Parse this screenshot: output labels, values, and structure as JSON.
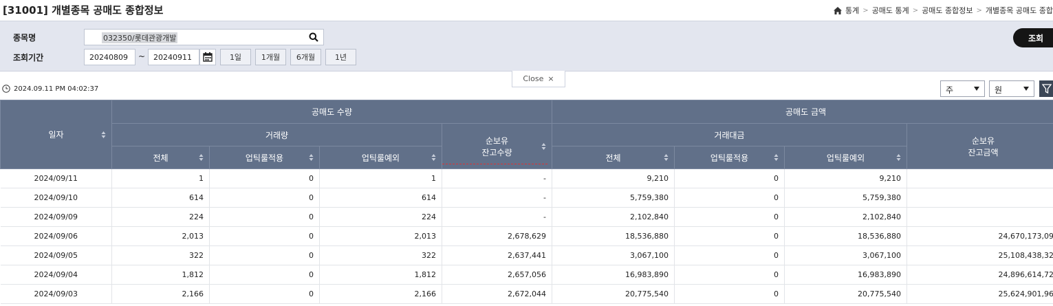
{
  "page": {
    "title": "[31001] 개별종목 공매도 종합정보",
    "breadcrumb": [
      "통계",
      "공매도 통계",
      "공매도 종합정보",
      "개별종목 공매도 종합"
    ]
  },
  "search": {
    "stock_label": "종목명",
    "stock_value": "032350/롯데관광개발",
    "period_label": "조회기간",
    "date_from": "20240809",
    "tilde": "~",
    "date_to": "20240911",
    "period_buttons": [
      "1일",
      "1개월",
      "6개월",
      "1년"
    ],
    "query_button": "조회",
    "close_label": "Close"
  },
  "toolbar": {
    "timestamp": "2024.09.11 PM 04:02:37",
    "unit_quantity": "주",
    "unit_amount": "원"
  },
  "table": {
    "header_group_quantity": "공매도 수량",
    "header_group_amount": "공매도 금액",
    "header_date": "일자",
    "header_volume": "거래량",
    "header_value": "거래대금",
    "header_net_qty_1": "순보유",
    "header_net_qty_2": "잔고수량",
    "header_net_amt_1": "순보유",
    "header_net_amt_2": "잔고금액",
    "header_total": "전체",
    "header_uptick_applied": "업틱룰적용",
    "header_uptick_exempt": "업틱룰예외",
    "rows": [
      [
        "2024/09/11",
        "1",
        "0",
        "1",
        "-",
        "9,210",
        "0",
        "9,210",
        ""
      ],
      [
        "2024/09/10",
        "614",
        "0",
        "614",
        "-",
        "5,759,380",
        "0",
        "5,759,380",
        ""
      ],
      [
        "2024/09/09",
        "224",
        "0",
        "224",
        "-",
        "2,102,840",
        "0",
        "2,102,840",
        ""
      ],
      [
        "2024/09/06",
        "2,013",
        "0",
        "2,013",
        "2,678,629",
        "18,536,880",
        "0",
        "18,536,880",
        "24,670,173,09"
      ],
      [
        "2024/09/05",
        "322",
        "0",
        "322",
        "2,637,441",
        "3,067,100",
        "0",
        "3,067,100",
        "25,108,438,32"
      ],
      [
        "2024/09/04",
        "1,812",
        "0",
        "1,812",
        "2,657,056",
        "16,983,890",
        "0",
        "16,983,890",
        "24,896,614,72"
      ],
      [
        "2024/09/03",
        "2,166",
        "0",
        "2,166",
        "2,672,044",
        "20,775,540",
        "0",
        "20,775,540",
        "25,624,901,96"
      ]
    ]
  }
}
